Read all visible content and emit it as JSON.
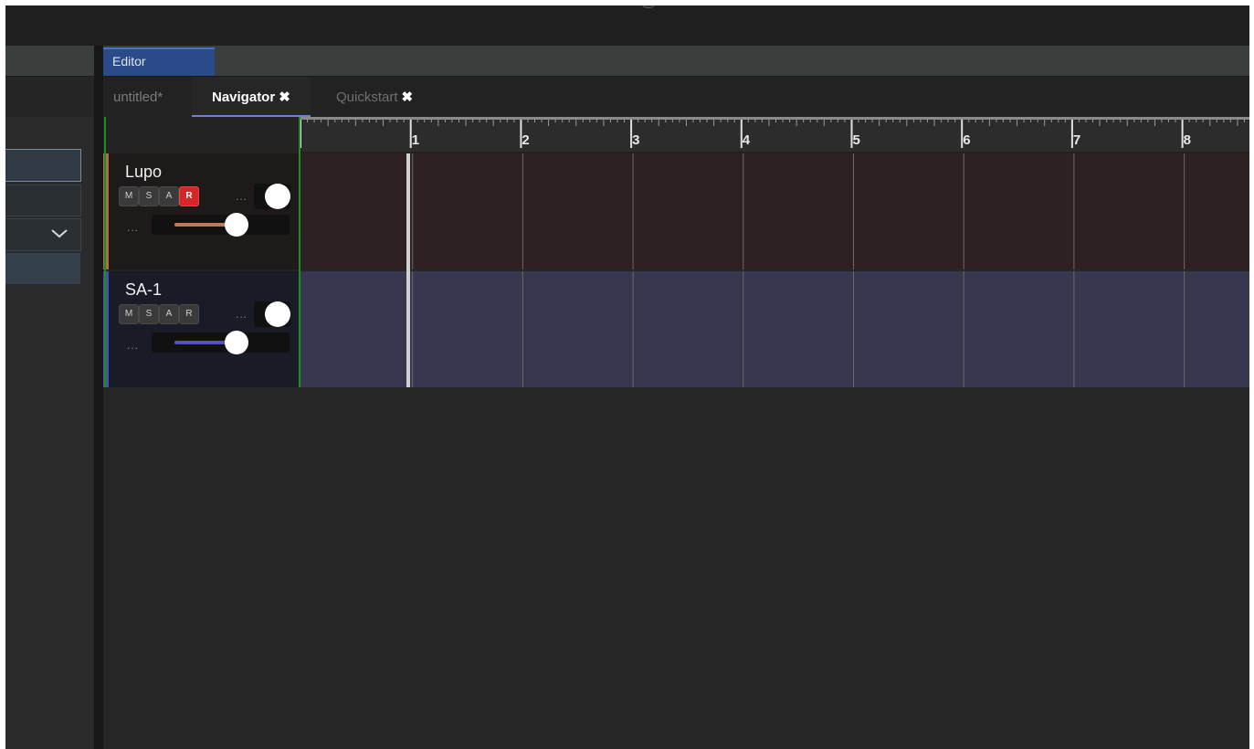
{
  "editor": {
    "tab_label": "Editor"
  },
  "doc_tabs": [
    {
      "label": "untitled*",
      "active": false,
      "closable": false
    },
    {
      "label": "Navigator",
      "active": true,
      "closable": true
    },
    {
      "label": "Quickstart",
      "active": false,
      "closable": true
    }
  ],
  "close_glyph": "✖",
  "ruler": {
    "labels": [
      "1",
      "2",
      "3",
      "4",
      "5",
      "6",
      "7",
      "8"
    ]
  },
  "tracks": [
    {
      "name": "Lupo",
      "color": "#b26c47",
      "buttons": [
        "M",
        "S",
        "A",
        "R"
      ],
      "record_armed": true,
      "more": "...",
      "more2": "..."
    },
    {
      "name": "SA-1",
      "color": "#4b4cb0",
      "buttons": [
        "M",
        "S",
        "A",
        "R"
      ],
      "record_armed": false,
      "more": "...",
      "more2": "..."
    }
  ],
  "icons": {
    "dropdown": "chevron-down-icon",
    "close": "close-icon"
  }
}
